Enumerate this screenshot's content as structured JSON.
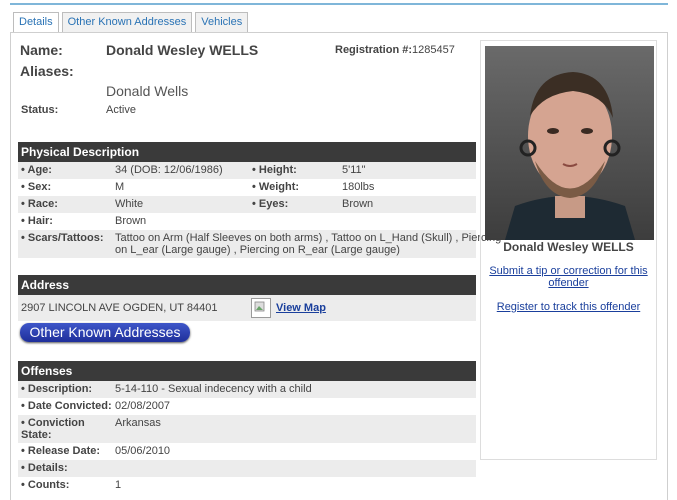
{
  "tabs": [
    {
      "label": "Details",
      "active": true
    },
    {
      "label": "Other Known Addresses",
      "active": false
    },
    {
      "label": "Vehicles",
      "active": false
    }
  ],
  "identity": {
    "name_label": "Name:",
    "name": "Donald Wesley WELLS",
    "registration_label": "Registration #:",
    "registration_number": "1285457",
    "aliases_label": "Aliases:",
    "alias": "Donald Wells",
    "status_label": "Status:",
    "status": "Active"
  },
  "physical": {
    "title": "Physical Description",
    "age_label": "• Age:",
    "age": "34  (DOB: 12/06/1986)",
    "height_label": "• Height:",
    "height": "5'11\"",
    "sex_label": "• Sex:",
    "sex": "M",
    "weight_label": "• Weight:",
    "weight": "180lbs",
    "race_label": "• Race:",
    "race": "White",
    "eyes_label": "• Eyes:",
    "eyes": "Brown",
    "hair_label": "• Hair:",
    "hair": "Brown",
    "scars_label": "• Scars/Tattoos:",
    "scars_line1": "Tattoo on Arm (Half Sleeves on both arms) , Tattoo on L_Hand (Skull) , Piercing",
    "scars_line2": "on L_ear (Large gauge) , Piercing on R_ear (Large gauge)"
  },
  "address": {
    "title": "Address",
    "value": "2907 LINCOLN AVE OGDEN, UT 84401",
    "map_link": "View Map",
    "other_button": "Other Known Addresses"
  },
  "offenses": {
    "title": "Offenses",
    "description_label": "• Description:",
    "description": "5-14-110 - Sexual indecency with a child",
    "convicted_label": "• Date Convicted:",
    "convicted": "02/08/2007",
    "state_label1": "• Conviction",
    "state_label2": "State:",
    "state": "Arkansas",
    "release_label": "• Release Date:",
    "release": "05/06/2010",
    "details_label": "• Details:",
    "counts_label": "• Counts:",
    "counts": "1"
  },
  "sidebar": {
    "photo_caption": "Donald Wesley WELLS",
    "tip_link_line1": "Submit a tip or correction for this",
    "tip_link_line2": "offender",
    "track_link": "Register to track this offender"
  },
  "colors": {
    "section_bar": "#3a3a3a",
    "link": "#1a3f9c",
    "tab_text": "#2a73b5",
    "button": "#2a3fb0"
  }
}
